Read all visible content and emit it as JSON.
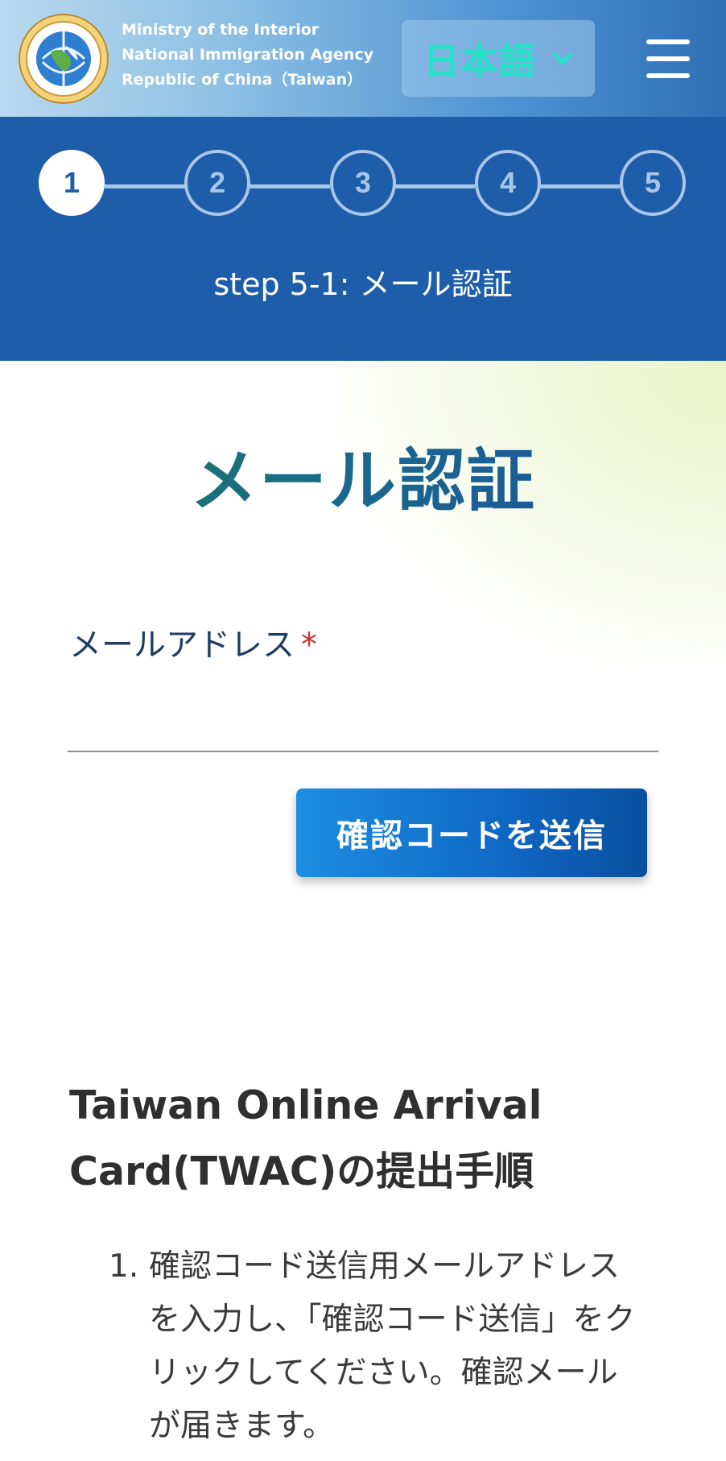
{
  "header": {
    "agency_lines": [
      "Ministry of the Interior",
      "National Immigration Agency",
      "Republic of China（Taiwan）"
    ],
    "language": "日本語",
    "colors": {
      "language_text": "#23e3c8"
    }
  },
  "stepper": {
    "steps": [
      "1",
      "2",
      "3",
      "4",
      "5"
    ],
    "current_step": 1,
    "caption": "step 5-1: メール認証"
  },
  "main": {
    "title": "メール認証",
    "email_label": "メールアドレス",
    "required_mark": "*",
    "email_value": "",
    "send_button": "確認コードを送信"
  },
  "instructions": {
    "title": "Taiwan Online Arrival Card(TWAC)の提出手順",
    "items": [
      {
        "number": "1.",
        "text": "確認コード送信用メールアドレスを入力し、「確認コード送信」をクリックしてください。確認メールが届きます。"
      }
    ]
  }
}
